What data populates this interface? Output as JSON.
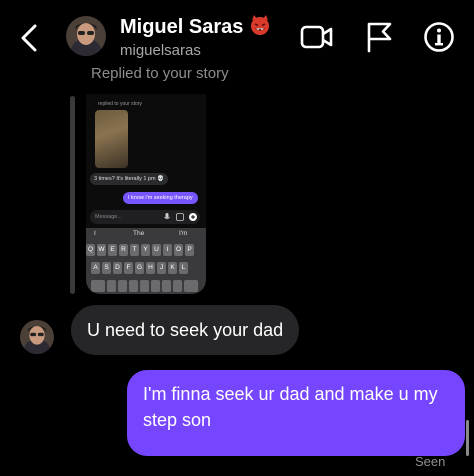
{
  "header": {
    "name": "Miguel Saras",
    "username": "miguelsaras",
    "icons": [
      "back-arrow-icon",
      "video-call-icon",
      "flag-icon",
      "info-icon",
      "devil-emoji-icon"
    ]
  },
  "story_reply": {
    "label": "Replied to your story",
    "preview": {
      "label": "replied to your story",
      "incoming_text": "3 times? It's literally 1 pm 💀",
      "outgoing_text": "I know i'm seeking therapy",
      "input_placeholder": "Message...",
      "suggestions": [
        "I",
        "The",
        "I'm"
      ],
      "keyboard_row_1": [
        "Q",
        "W",
        "E",
        "R",
        "T",
        "Y",
        "U",
        "I",
        "O",
        "P"
      ],
      "keyboard_row_2": [
        "A",
        "S",
        "D",
        "F",
        "G",
        "H",
        "J",
        "K",
        "L"
      ]
    }
  },
  "messages": [
    {
      "direction": "incoming",
      "text": "U need to seek your dad"
    },
    {
      "direction": "outgoing",
      "text": "I'm finna seek ur dad and make u my step son"
    }
  ],
  "status": {
    "seen": "Seen"
  },
  "colors": {
    "background": "#000000",
    "outgoing_bubble": "#7646ff",
    "incoming_bubble": "#262628"
  }
}
